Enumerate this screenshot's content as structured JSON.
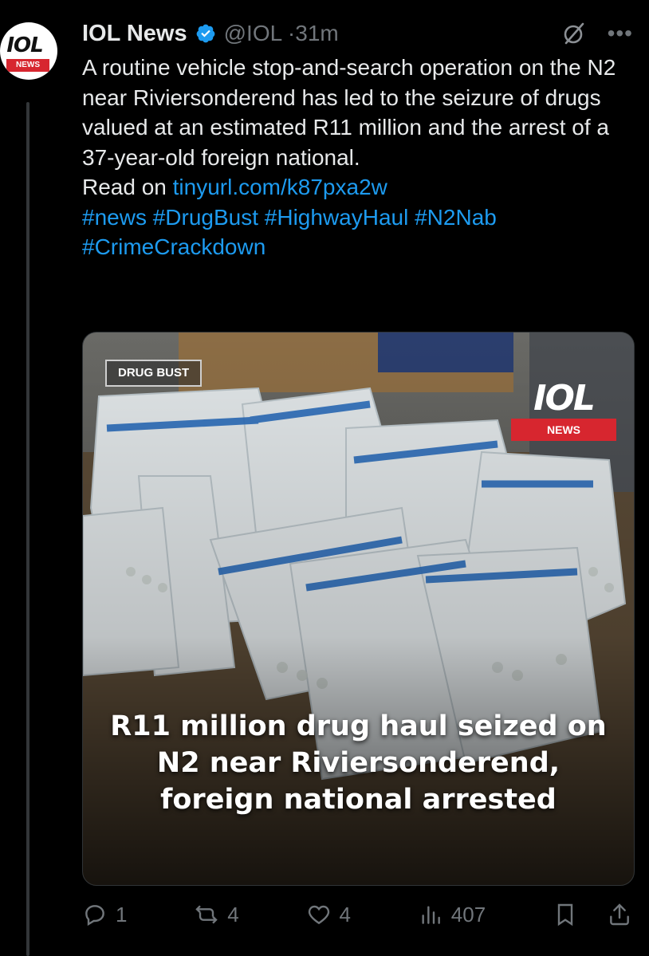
{
  "account": {
    "name": "IOL News",
    "handle": "@IOL",
    "separator": "·",
    "time": "31m",
    "avatar_logo": "IOL",
    "avatar_tag": "NEWS"
  },
  "tweet": {
    "text_line1": "A routine vehicle stop-and-search operation on the N2 near Riviersonderend has led to the seizure of drugs valued at an estimated R11 million and the arrest of a 37-year-old foreign national.",
    "read_on_label": "Read on ",
    "link": "tinyurl.com/k87pxa2w",
    "hashtags": "#news #DrugBust #HighwayHaul #N2Nab #CrimeCrackdown"
  },
  "media": {
    "tag": "DRUG BUST",
    "logo": "IOL",
    "logo_bar": "NEWS",
    "headline_1": "R11 million drug haul seized on",
    "headline_2": "N2 near Riviersonderend,",
    "headline_3": "foreign national arrested"
  },
  "actions": {
    "replies": "1",
    "reposts": "4",
    "likes": "4",
    "views": "407"
  },
  "colors": {
    "background": "#000000",
    "text": "#e7e9ea",
    "secondary": "#71767b",
    "link": "#1d9bf0",
    "brand_red": "#d7262f"
  }
}
